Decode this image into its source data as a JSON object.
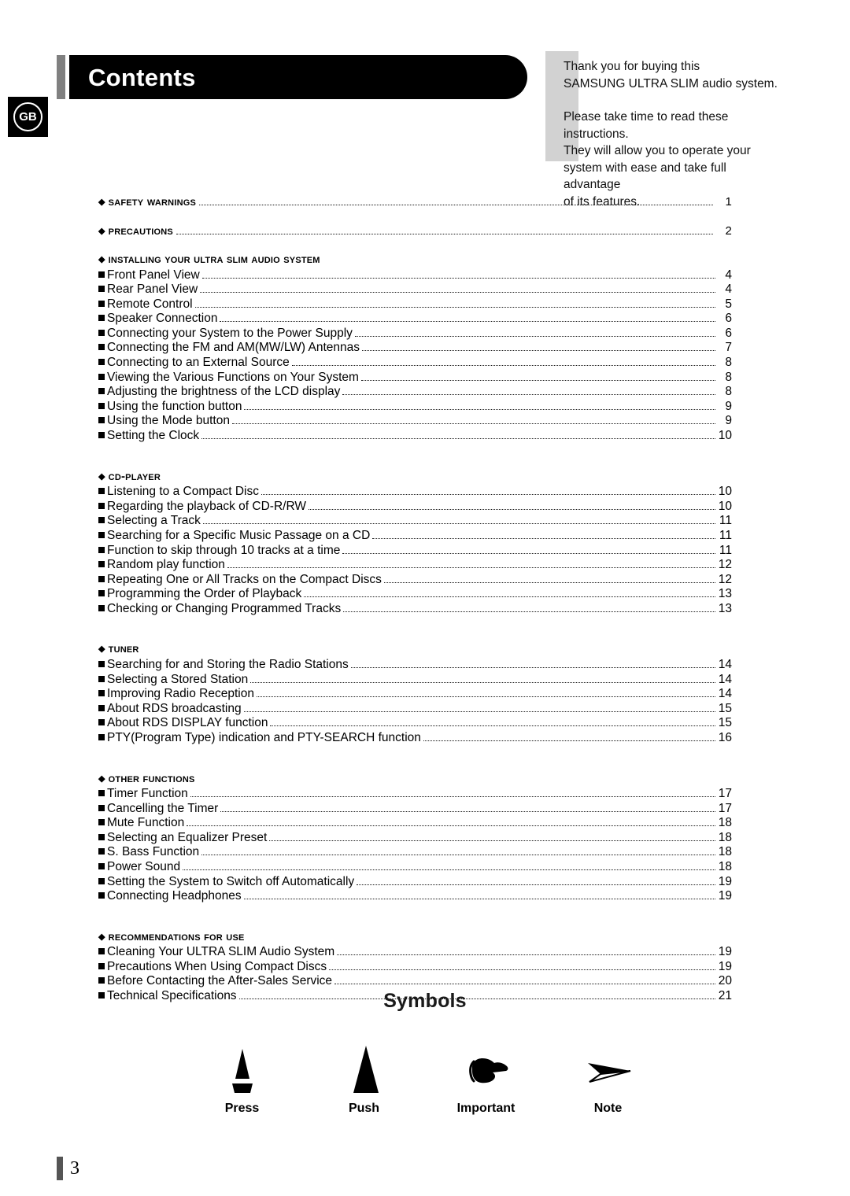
{
  "header": {
    "title": "Contents",
    "region_badge": "GB"
  },
  "intro": {
    "paragraph1_line1": "Thank you for buying this",
    "paragraph1_line2": "SAMSUNG ULTRA SLIM audio system.",
    "paragraph2_line1": "Please take time to read these instructions.",
    "paragraph2_line2": "They will allow you to operate your",
    "paragraph2_line3": "system with ease and take full advantage",
    "paragraph2_line4": "of its features."
  },
  "toc": {
    "sections": [
      {
        "label": "Safety Warnings",
        "page": "1",
        "has_leader": true,
        "items": []
      },
      {
        "label": "Precautions",
        "page": "2",
        "has_leader": true,
        "items": []
      },
      {
        "label": "Installing Your Ultra Slim Audio System",
        "page": "",
        "has_leader": false,
        "items": [
          {
            "label": "Front Panel View",
            "page": "4"
          },
          {
            "label": "Rear Panel View",
            "page": "4"
          },
          {
            "label": "Remote Control",
            "page": "5"
          },
          {
            "label": "Speaker Connection",
            "page": "6"
          },
          {
            "label": "Connecting your System to the Power Supply",
            "page": "6"
          },
          {
            "label": "Connecting the FM and AM(MW/LW) Antennas",
            "page": "7"
          },
          {
            "label": "Connecting to an External Source",
            "page": "8"
          },
          {
            "label": "Viewing the Various Functions on Your System",
            "page": "8"
          },
          {
            "label": "Adjusting the brightness of the LCD display",
            "page": "8"
          },
          {
            "label": "Using the function button",
            "page": "9"
          },
          {
            "label": "Using the Mode button",
            "page": "9"
          },
          {
            "label": "Setting the Clock",
            "page": "10"
          }
        ]
      },
      {
        "label": "CD-Player",
        "page": "",
        "has_leader": false,
        "items": [
          {
            "label": "Listening to a Compact Disc",
            "page": "10"
          },
          {
            "label": "Regarding the playback of CD-R/RW",
            "page": "10"
          },
          {
            "label": "Selecting a Track",
            "page": "11"
          },
          {
            "label": "Searching for a Specific Music Passage on a CD",
            "page": "11"
          },
          {
            "label": "Function to skip through 10 tracks at a time",
            "page": "11"
          },
          {
            "label": "Random play function",
            "page": "12"
          },
          {
            "label": "Repeating One or All Tracks on the Compact Discs",
            "page": "12"
          },
          {
            "label": "Programming the Order of Playback",
            "page": "13"
          },
          {
            "label": "Checking or Changing Programmed Tracks",
            "page": "13"
          }
        ]
      },
      {
        "label": "Tuner",
        "page": "",
        "has_leader": false,
        "items": [
          {
            "label": "Searching for and Storing the Radio Stations",
            "page": "14"
          },
          {
            "label": "Selecting a Stored Station",
            "page": "14"
          },
          {
            "label": "Improving Radio Reception",
            "page": "14"
          },
          {
            "label": "About RDS broadcasting",
            "page": "15"
          },
          {
            "label": "About RDS DISPLAY function",
            "page": "15"
          },
          {
            "label": "PTY(Program Type) indication and PTY-SEARCH function",
            "page": "16"
          }
        ]
      },
      {
        "label": "Other Functions",
        "page": "",
        "has_leader": false,
        "items": [
          {
            "label": "Timer Function",
            "page": "17"
          },
          {
            "label": "Cancelling the Timer",
            "page": "17"
          },
          {
            "label": "Mute Function",
            "page": "18"
          },
          {
            "label": "Selecting an Equalizer Preset",
            "page": "18"
          },
          {
            "label": "S. Bass Function",
            "page": "18"
          },
          {
            "label": "Power Sound",
            "page": "18"
          },
          {
            "label": "Setting the System to Switch off Automatically",
            "page": "19"
          },
          {
            "label": "Connecting Headphones",
            "page": "19"
          }
        ]
      },
      {
        "label": "Recommendations for Use",
        "page": "",
        "has_leader": false,
        "items": [
          {
            "label": "Cleaning Your ULTRA SLIM Audio System",
            "page": "19"
          },
          {
            "label": "Precautions When Using Compact Discs",
            "page": "19"
          },
          {
            "label": "Before Contacting the After-Sales Service",
            "page": "20"
          },
          {
            "label": "Technical Specifications",
            "page": "21"
          }
        ]
      }
    ]
  },
  "symbols": {
    "title": "Symbols",
    "items": [
      {
        "label": "Press",
        "icon": "split-triangle-icon"
      },
      {
        "label": "Push",
        "icon": "solid-triangle-icon"
      },
      {
        "label": "Important",
        "icon": "pointing-hand-icon"
      },
      {
        "label": "Note",
        "icon": "dart-arrow-icon"
      }
    ]
  },
  "footer": {
    "page_number": "3"
  },
  "colors": {
    "banner_background": "#000000",
    "banner_accent": "#808080",
    "intro_block": "#d2d2d2",
    "footer_bar": "#555555",
    "text": "#000000"
  }
}
